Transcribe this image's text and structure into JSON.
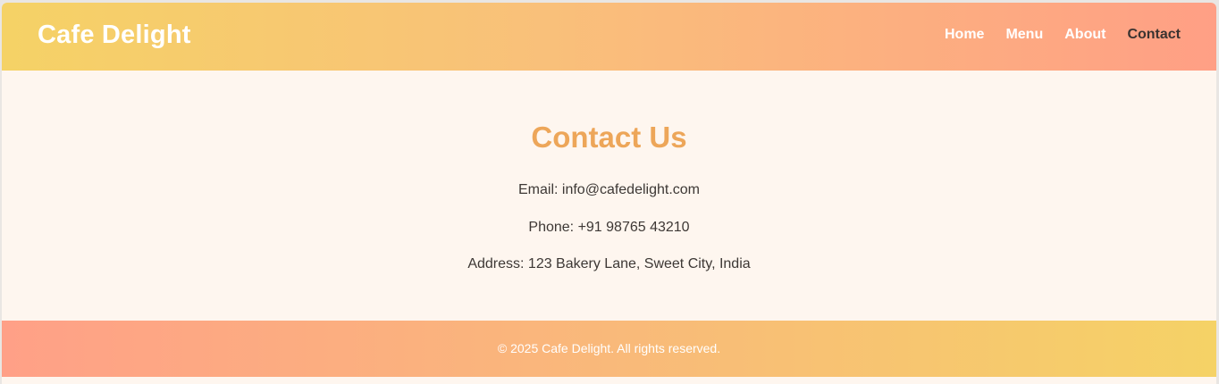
{
  "header": {
    "brand": "Cafe Delight",
    "nav": [
      {
        "label": "Home",
        "active": false
      },
      {
        "label": "Menu",
        "active": false
      },
      {
        "label": "About",
        "active": false
      },
      {
        "label": "Contact",
        "active": true
      }
    ]
  },
  "main": {
    "title": "Contact Us",
    "email": "Email: info@cafedelight.com",
    "phone": "Phone: +91 98765 43210",
    "address": "Address: 123 Bakery Lane, Sweet City, India"
  },
  "footer": {
    "text": "© 2025 Cafe Delight. All rights reserved."
  },
  "colors": {
    "accent": "#eda659",
    "background": "#fef6ef",
    "nav_active": "#3a3330"
  }
}
